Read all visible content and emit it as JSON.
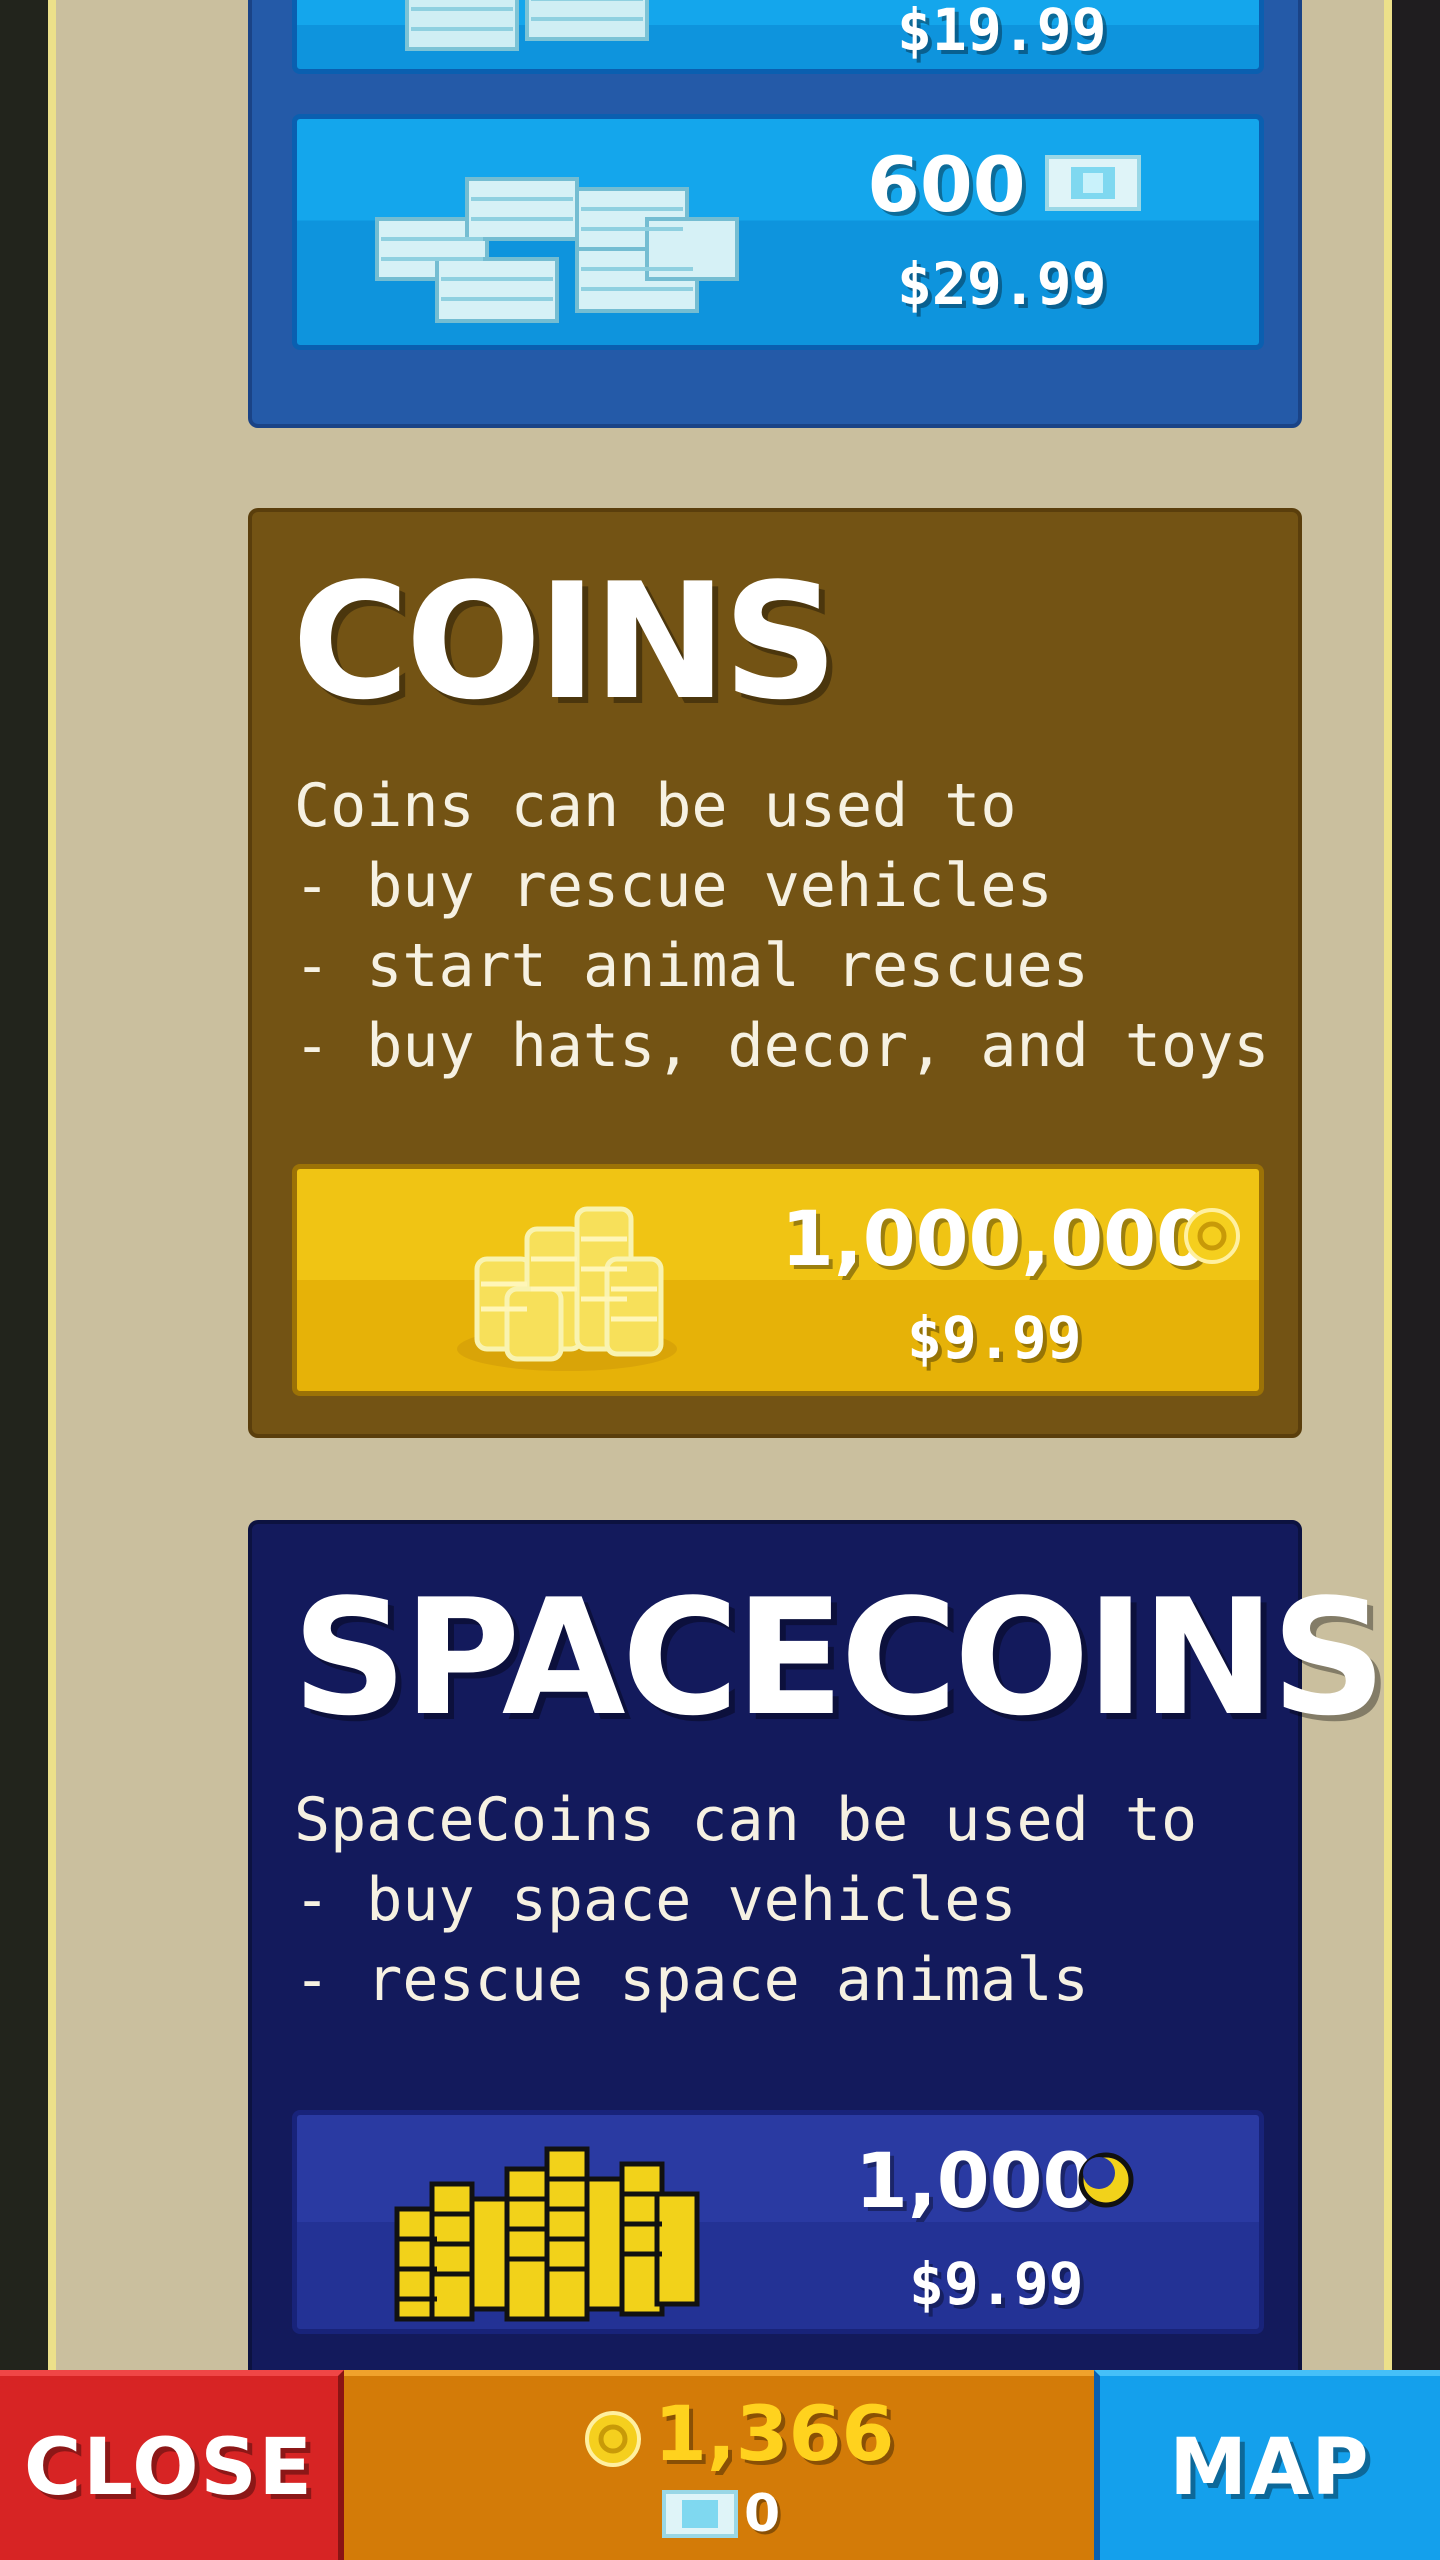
{
  "gems": {
    "offers": [
      {
        "amount": "",
        "price": "$19.99"
      },
      {
        "amount": "600",
        "price": "$29.99"
      }
    ]
  },
  "coins": {
    "title": "COINS",
    "description": [
      "Coins can be used to",
      "- buy rescue vehicles",
      "- start animal rescues",
      "- buy hats, decor, and toys"
    ],
    "offer": {
      "amount": "1,000,000",
      "price": "$9.99"
    }
  },
  "spacecoins": {
    "title": "SPACECOINS",
    "description": [
      "SpaceCoins can be used to",
      "- buy space vehicles",
      "- rescue space animals"
    ],
    "offer": {
      "amount": "1,000",
      "price": "$9.99"
    }
  },
  "bottom_bar": {
    "close_label": "CLOSE",
    "map_label": "MAP",
    "coin_balance": "1,366",
    "gem_balance": "0"
  },
  "icons": [
    "gem-bundle-icon",
    "gem-icon",
    "coin-pile-icon",
    "coin-icon",
    "spacecoin-stacks-icon",
    "spacecoin-icon"
  ],
  "colors": {
    "gem_section": "#245aa8",
    "coin_section": "#735314",
    "spacecoin_section": "#131a5c",
    "close_button": "#d72424",
    "map_button": "#14a0ec",
    "balance_bar": "#d37b08"
  }
}
